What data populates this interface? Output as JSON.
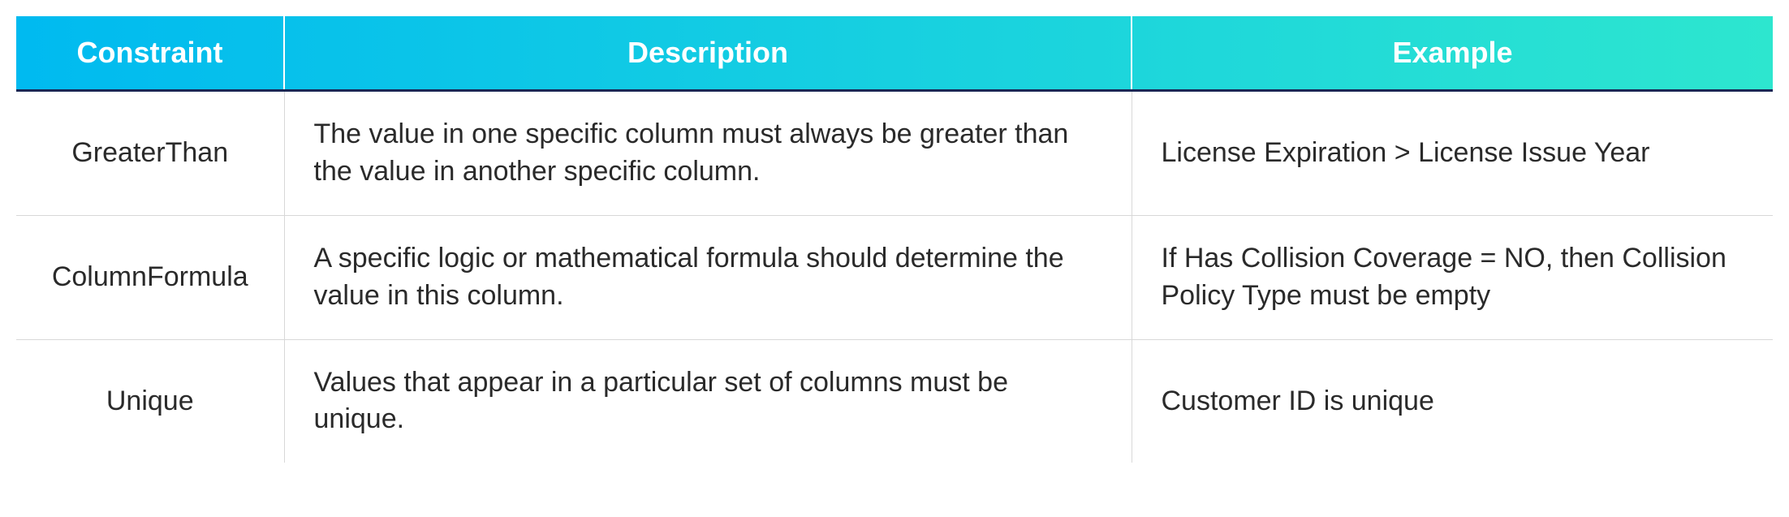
{
  "table": {
    "headers": {
      "constraint": "Constraint",
      "description": "Description",
      "example": "Example"
    },
    "rows": [
      {
        "constraint": "GreaterThan",
        "description": "The value in one specific column must always be greater than the value in another specific column.",
        "example": "License Expiration > License Issue Year"
      },
      {
        "constraint": "ColumnFormula",
        "description": "A specific logic or mathematical formula should determine the value in this column.",
        "example": "If Has Collision Coverage = NO, then Collision Policy Type must be empty"
      },
      {
        "constraint": "Unique",
        "description": "Values that appear in a particular set of columns must be unique.",
        "example": "Customer ID is unique"
      }
    ]
  }
}
